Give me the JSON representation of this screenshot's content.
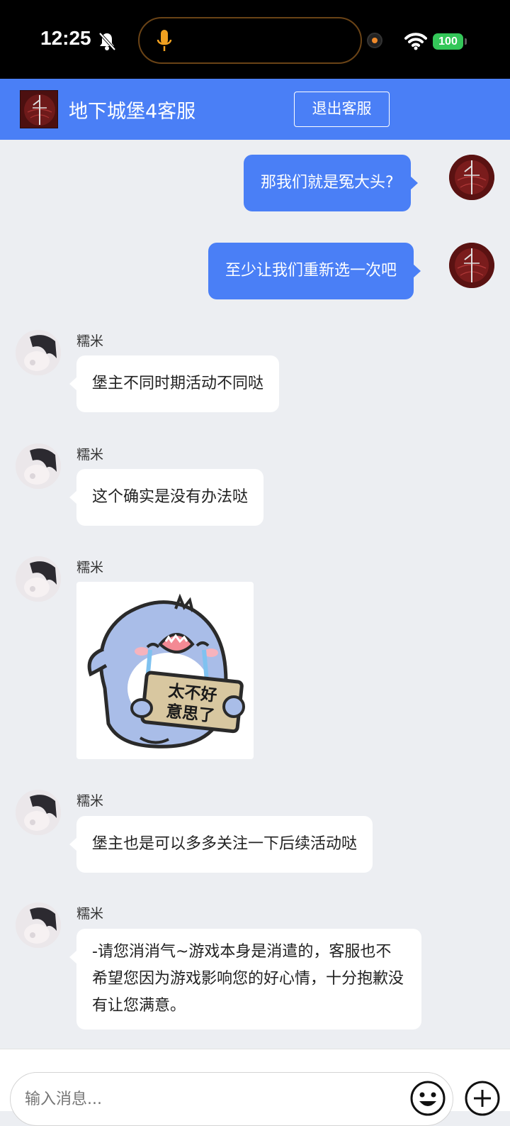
{
  "status_bar": {
    "time": "12:25",
    "battery": "100"
  },
  "header": {
    "title": "地下城堡4客服",
    "exit_label": "退出客服"
  },
  "messages_out": [
    {
      "text": "那我们就是冤大头?"
    },
    {
      "text": "至少让我们重新选一次吧"
    }
  ],
  "messages_in": [
    {
      "sender": "糯米",
      "text": "堡主不同时期活动不同哒"
    },
    {
      "sender": "糯米",
      "text": "这个确实是没有办法哒"
    },
    {
      "sender": "糯米",
      "sticker_text": "太不好意思了"
    },
    {
      "sender": "糯米",
      "text": "堡主也是可以多多关注一下后续活动哒"
    },
    {
      "sender": "糯米",
      "text": "-请您消消气~游戏本身是消遣的，客服也不希望您因为游戏影响您的好心情，十分抱歉没有让您满意。"
    }
  ],
  "input": {
    "placeholder": "输入消息..."
  },
  "colors": {
    "accent": "#4a7ff6",
    "background": "#eceef2"
  }
}
